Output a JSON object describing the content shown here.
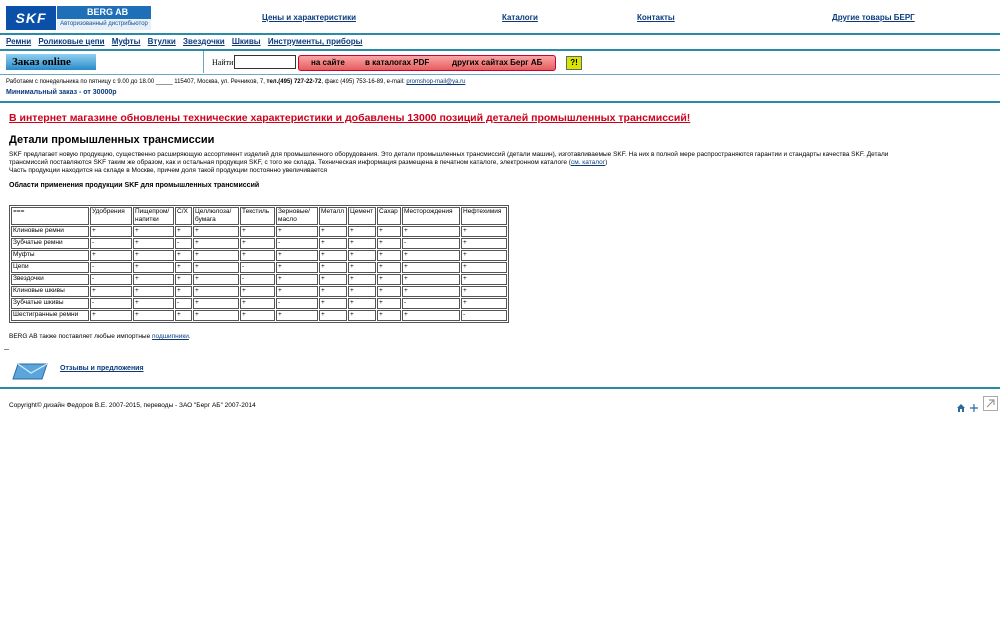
{
  "header": {
    "logo_skf": "SKF",
    "logo_berg": "BERG AB",
    "logo_sub": "Авторизованный дистрибьютор",
    "links": [
      "Цены и характеристики",
      "Каталоги",
      "Контакты",
      "Другие товары БЕРГ"
    ]
  },
  "nav": [
    "Ремни",
    "Роликовые цепи",
    "Муфты",
    "Втулки",
    "Звездочки",
    "Шкивы",
    "Инструменты, приборы"
  ],
  "order": {
    "button": "Заказ online",
    "find_label": "Найти",
    "search_buttons": [
      "на сайте",
      "в каталогах PDF",
      "других сайтах Берг АБ"
    ],
    "help": "?!"
  },
  "info": {
    "hours": "Работаем с понедельника по пятницу с 9.00 до 18.00 _____ 115407, Москва, ул. Речников, 7, ",
    "phone": "тел.(495) 727-22-72",
    "fax": ", факс (495) 753-16-89, e-mail: ",
    "email": "promshop-mail@ya.ru",
    "min_order": "Минимальный заказ - от 30000р"
  },
  "headline": "В интернет магазине обновлены технические характеристики и добавлены 13000 позиций деталей промышленных трансмиссий!",
  "section_title": "Детали промышленных трансмиссии",
  "paragraph": {
    "text": "SKF предлагает новую продукцию, существенно расширяющую ассортимент изделий для промышленного оборудования. Это детали промышленных трансмиссий (детали машин), изготавливаемые SKF. На них в полной мере распространяются гарантии и стандарты качества SKF. Детали трансмиссий поставляются SKF таким же образом, как и остальная продукция SKF, с того же склада. Техническая информация размещена в печатном каталоге, электронном каталоге (",
    "link": "см. каталог",
    "after": ")",
    "line2": "Часть продукции находится на складе в Москве, причем доля такой продукции постоянно увеличивается"
  },
  "table_title": "Области применения продукции SKF для промышленных трансмиссий",
  "table": {
    "headers": [
      "===",
      "Удобрения",
      "Пищепром/ напитки",
      "С/Х",
      "Целлюлоза/ бумага",
      "Текстиль",
      "Зерновые/ масло",
      "Металл",
      "Цемент",
      "Сахар",
      "Месторождения",
      "Нефтехимия"
    ],
    "rows": [
      [
        "Клиновые ремни",
        "+",
        "+",
        "+",
        "+",
        "+",
        "+",
        "+",
        "+",
        "+",
        "+",
        "+"
      ],
      [
        "Зубчатые ремни",
        "-",
        "+",
        "-",
        "+",
        "+",
        "-",
        "+",
        "+",
        "+",
        "-",
        "+"
      ],
      [
        "Муфты",
        "+",
        "+",
        "+",
        "+",
        "+",
        "+",
        "+",
        "+",
        "+",
        "+",
        "+"
      ],
      [
        "Цепи",
        "-",
        "+",
        "+",
        "+",
        "-",
        "+",
        "+",
        "+",
        "+",
        "+",
        "+"
      ],
      [
        "Звездочки",
        "-",
        "+",
        "+",
        "+",
        "-",
        "+",
        "+",
        "+",
        "+",
        "+",
        "+"
      ],
      [
        "Клиновые шкивы",
        "+",
        "+",
        "+",
        "+",
        "+",
        "+",
        "+",
        "+",
        "+",
        "+",
        "+"
      ],
      [
        "Зубчатые шкивы",
        "-",
        "+",
        "-",
        "+",
        "+",
        "-",
        "+",
        "+",
        "+",
        "-",
        "+"
      ],
      [
        "Шестигранные ремни",
        "+",
        "+",
        "+",
        "+",
        "+",
        "+",
        "+",
        "+",
        "+",
        "+",
        "-"
      ]
    ]
  },
  "also": {
    "text": "BERG AB также поставляет любые импортные ",
    "link": "подшипники",
    "end": "."
  },
  "feedback": "Отзывы и предложения",
  "copyright": "Copyright© дизайн Федоров В.Е. 2007-2015, переводы - ЗАО \"Берг АБ\" 2007-2014",
  "colors": {
    "accent_bar": "#2a8aa8",
    "headline": "#d0001a",
    "link": "#0b3a7a"
  }
}
